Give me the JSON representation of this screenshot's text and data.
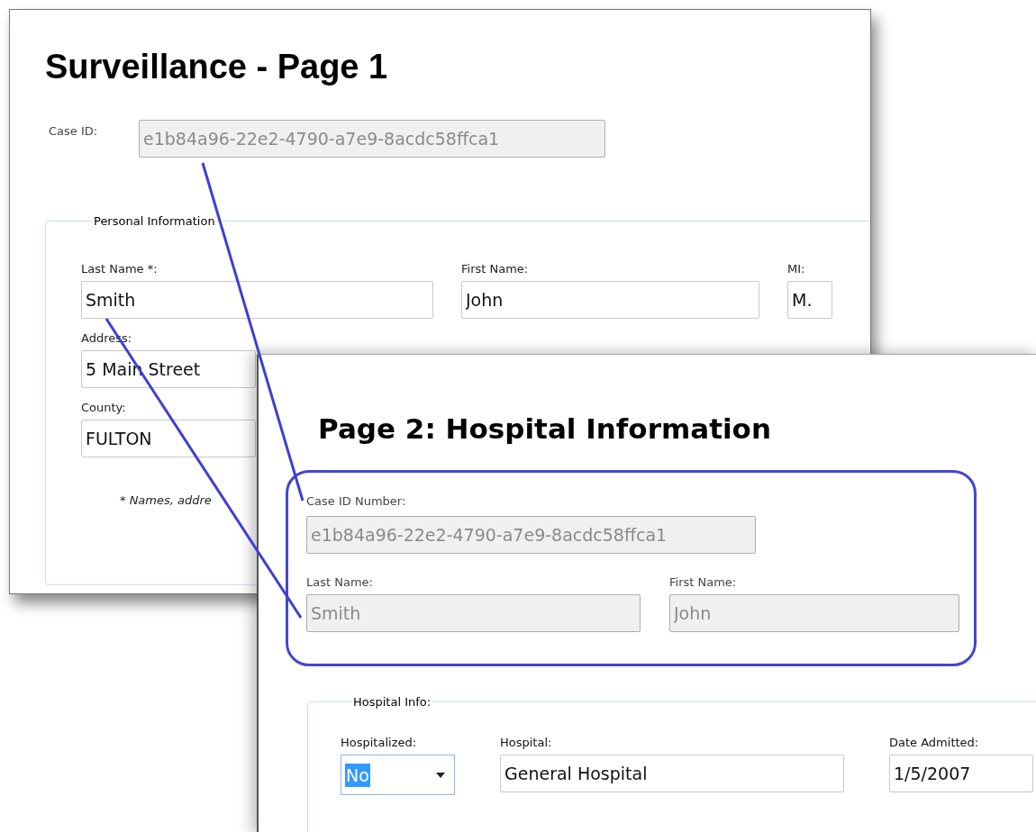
{
  "page1": {
    "title": "Surveillance - Page 1",
    "case_id": {
      "label": "Case ID:",
      "value": "e1b84a96-22e2-4790-a7e9-8acdc58ffca1",
      "disabled": true
    },
    "personal_info": {
      "legend": "Personal Information",
      "name_fields": [
        {
          "label": "Last Name *:",
          "value": "Smith",
          "disabled": false
        },
        {
          "label": "First Name:",
          "value": "John",
          "disabled": false
        },
        {
          "label": "MI:",
          "value": "M.",
          "disabled": false
        }
      ],
      "address": {
        "label": "Address:",
        "value": "5 Main Street",
        "disabled": false
      },
      "county": {
        "label": "County:",
        "value": "FULTON",
        "disabled": false
      },
      "footnote": "* Names, addre"
    }
  },
  "page2": {
    "title": "Page 2: Hospital Information",
    "case_id": {
      "label": "Case ID Number:",
      "value": "e1b84a96-22e2-4790-a7e9-8acdc58ffca1",
      "disabled": true
    },
    "name_fields": [
      {
        "label": "Last Name:",
        "value": "Smith",
        "disabled": true
      },
      {
        "label": "First Name:",
        "value": "John",
        "disabled": true
      }
    ],
    "hospital_info": {
      "legend": "Hospital Info:",
      "hospitalized": {
        "label": "Hospitalized:",
        "value": "No",
        "selected": true
      },
      "hospital": {
        "label": "Hospital:",
        "value": "General Hospital",
        "disabled": false
      },
      "date_admitted": {
        "label": "Date Admitted:",
        "value": "1/5/2007",
        "disabled": false
      }
    }
  }
}
